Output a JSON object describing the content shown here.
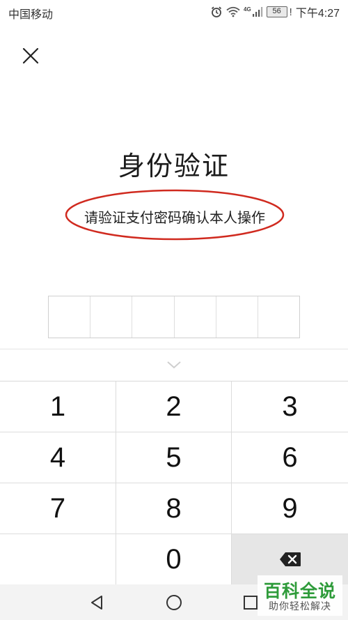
{
  "status_bar": {
    "carrier": "中国移动",
    "network_label": "4G",
    "battery_level": "56",
    "battery_alert": "!",
    "time": "下午4:27"
  },
  "icons": {
    "close": "close-icon",
    "alarm": "alarm-icon",
    "wifi": "wifi-icon",
    "signal": "signal-icon",
    "battery": "battery-icon",
    "collapse": "chevron-down-icon",
    "backspace": "backspace-icon",
    "nav_back": "triangle-back-icon",
    "nav_home": "circle-home-icon",
    "nav_recent": "square-recent-icon"
  },
  "auth": {
    "title": "身份验证",
    "subtitle": "请验证支付密码确认本人操作",
    "pin_length": 6
  },
  "keypad": {
    "keys": [
      "1",
      "2",
      "3",
      "4",
      "5",
      "6",
      "7",
      "8",
      "9",
      "",
      "0",
      "⌫"
    ]
  },
  "watermark": {
    "title": "百科全说",
    "subtitle": "助你轻松解决"
  },
  "colors": {
    "annotation_ellipse": "#d02a1f",
    "watermark_green": "#2e9b3a",
    "delete_key_bg": "#e6e6e6"
  }
}
